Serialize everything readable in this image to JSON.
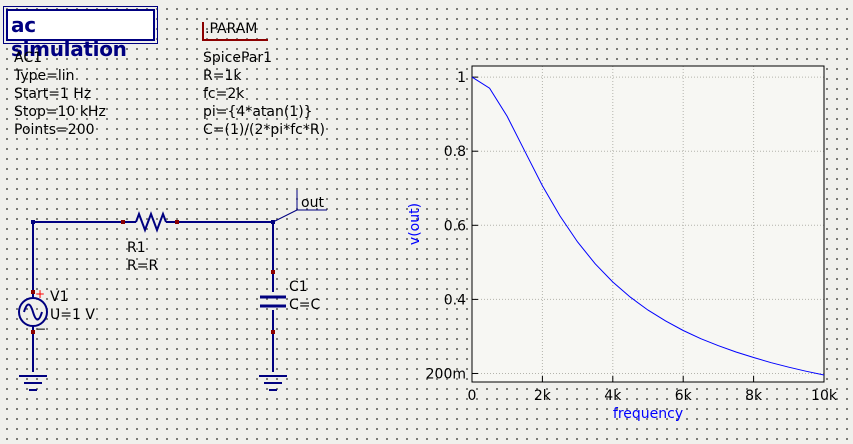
{
  "ac_simulation": {
    "title": "ac simulation",
    "name": "AC1",
    "params": [
      "Type=lin",
      "Start=1 Hz",
      "Stop=10 kHz",
      "Points=200"
    ]
  },
  "param_block": {
    "title": ".PARAM",
    "name": "SpicePar1",
    "lines": [
      "R=1k",
      "fc=2k",
      "pi={4*atan(1)}",
      "C=(1)/(2*pi*fc*R)"
    ]
  },
  "schematic": {
    "resistor": {
      "name": "R1",
      "value": "R=R"
    },
    "source": {
      "name": "V1",
      "value": "U=1 V",
      "plus": "+",
      "minus": "−"
    },
    "capacitor": {
      "name": "C1",
      "value": "C=C"
    },
    "node_label": "out"
  },
  "chart_data": {
    "type": "line",
    "xlabel": "frequency",
    "ylabel": "v(out)",
    "xlim": [
      0,
      10000
    ],
    "ylim": [
      0.177,
      1.03
    ],
    "x_ticks": [
      0,
      2000,
      4000,
      6000,
      8000,
      10000
    ],
    "x_tick_labels": [
      "0",
      "2k",
      "4k",
      "6k",
      "8k",
      "10k"
    ],
    "y_ticks": [
      0.2,
      0.4,
      0.6,
      0.8,
      1.0
    ],
    "y_tick_labels": [
      "200m",
      "0.4",
      "0.6",
      "0.8",
      "1"
    ],
    "grid": true,
    "series": [
      {
        "color": "#0000ff",
        "x": [
          0,
          500,
          1000,
          1500,
          2000,
          2500,
          3000,
          3500,
          4000,
          4500,
          5000,
          5500,
          6000,
          6500,
          7000,
          7500,
          8000,
          8500,
          9000,
          9500,
          10000
        ],
        "values": [
          1.0,
          0.97,
          0.894,
          0.8,
          0.707,
          0.625,
          0.555,
          0.496,
          0.447,
          0.406,
          0.371,
          0.342,
          0.316,
          0.294,
          0.275,
          0.258,
          0.243,
          0.229,
          0.217,
          0.206,
          0.196
        ]
      }
    ]
  }
}
